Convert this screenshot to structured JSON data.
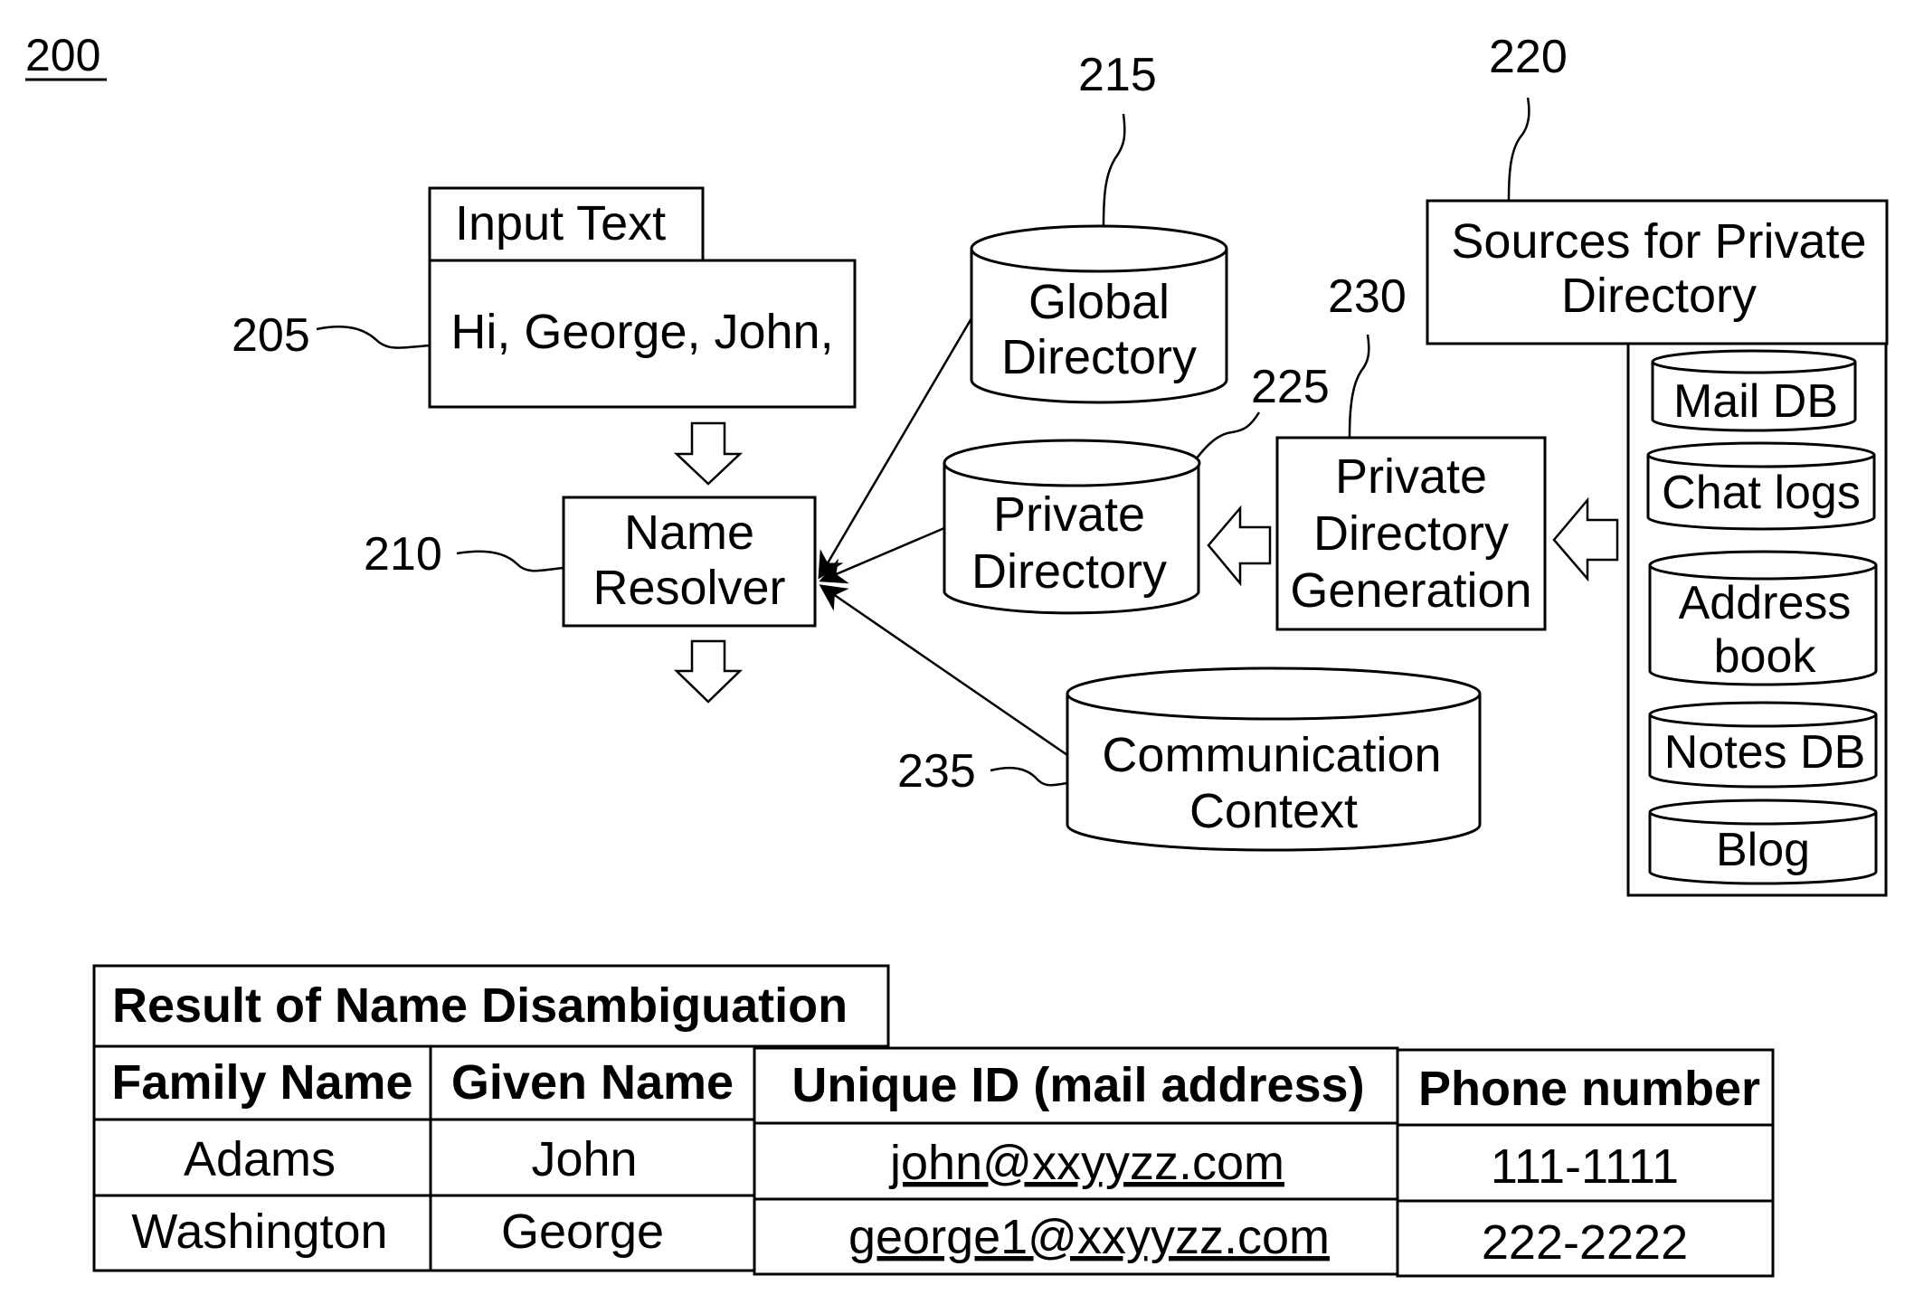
{
  "figure": {
    "number": "200",
    "input_text": {
      "ref": "205",
      "header": "Input Text",
      "content": "Hi, George, John,"
    },
    "name_resolver": {
      "ref": "210",
      "lines": [
        "Name",
        "Resolver"
      ]
    },
    "global_directory": {
      "ref": "215",
      "lines": [
        "Global",
        "Directory"
      ]
    },
    "sources": {
      "ref": "220",
      "lines": [
        "Sources for Private",
        "Directory"
      ],
      "items": [
        {
          "lines": [
            "Mail DB"
          ]
        },
        {
          "lines": [
            "Chat logs"
          ]
        },
        {
          "lines": [
            "Address",
            "book"
          ]
        },
        {
          "lines": [
            "Notes DB"
          ]
        },
        {
          "lines": [
            "Blog"
          ]
        }
      ]
    },
    "private_directory": {
      "ref": "225",
      "lines": [
        "Private",
        "Directory"
      ]
    },
    "private_directory_generation": {
      "ref": "230",
      "lines": [
        "Private",
        "Directory",
        "Generation"
      ]
    },
    "communication_context": {
      "ref": "235",
      "lines": [
        "Communication",
        "Context"
      ]
    }
  },
  "result_table": {
    "title": "Result of  Name Disambiguation",
    "columns": [
      "Family Name",
      "Given Name",
      "Unique ID (mail address)",
      "Phone number"
    ],
    "rows": [
      [
        "Adams",
        "John",
        "john@xxyyzz.com",
        "111-1111"
      ],
      [
        "Washington",
        "George",
        "george1@xxyyzz.com",
        "222-2222"
      ]
    ]
  }
}
